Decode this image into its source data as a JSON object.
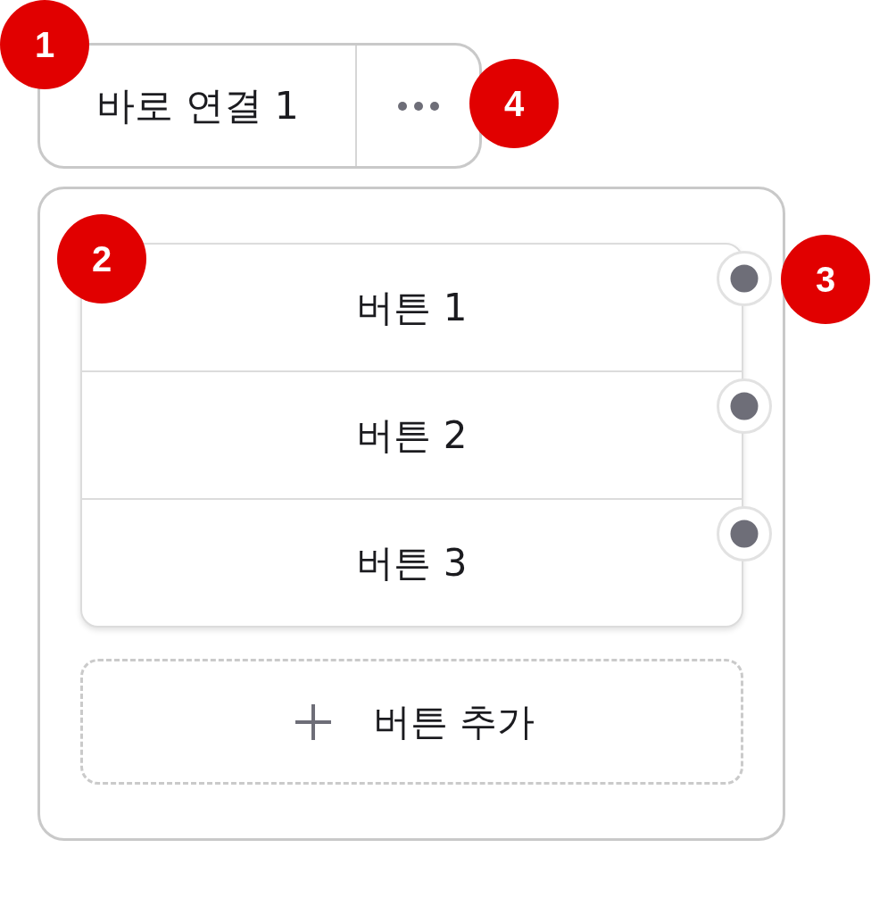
{
  "quick_link": {
    "label": "바로 연결 1",
    "callout": "1",
    "more_callout": "4"
  },
  "button_panel": {
    "callout": "2",
    "buttons": [
      {
        "label": "버튼 1",
        "handle_callout": "3"
      },
      {
        "label": "버튼 2"
      },
      {
        "label": "버튼 3"
      }
    ],
    "add_button": {
      "label": "버튼 추가"
    }
  }
}
